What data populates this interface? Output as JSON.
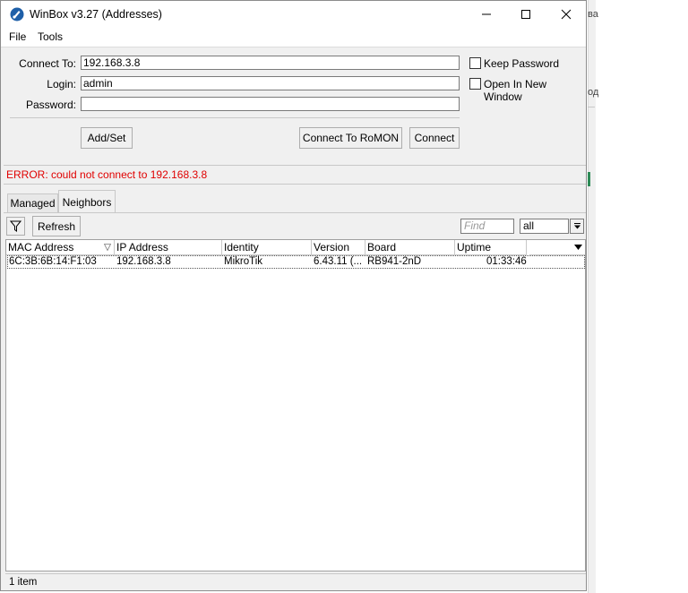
{
  "window": {
    "title": "WinBox v3.27 (Addresses)"
  },
  "menu": {
    "items": [
      {
        "label": "File"
      },
      {
        "label": "Tools"
      }
    ]
  },
  "form": {
    "connect_to_label": "Connect To:",
    "connect_to_value": "192.168.3.8",
    "login_label": "Login:",
    "login_value": "admin",
    "password_label": "Password:",
    "password_value": "",
    "keep_password_label": "Keep Password",
    "open_new_window_label": "Open In New Window"
  },
  "buttons": {
    "add_set": "Add/Set",
    "connect_romon": "Connect To RoMON",
    "connect": "Connect"
  },
  "error": {
    "message": "ERROR: could not connect to 192.168.3.8"
  },
  "tabs": [
    {
      "label": "Managed"
    },
    {
      "label": "Neighbors"
    }
  ],
  "toolbar": {
    "refresh_label": "Refresh",
    "find_placeholder": "Find",
    "filter_value": "all"
  },
  "table": {
    "columns": [
      "MAC Address",
      "IP Address",
      "Identity",
      "Version",
      "Board",
      "Uptime"
    ],
    "rows": [
      {
        "mac": "6C:3B:6B:14:F1:03",
        "ip": "192.168.3.8",
        "identity": "MikroTik",
        "version": "6.43.11 (...",
        "board": "RB941-2nD",
        "uptime": "01:33:46"
      }
    ]
  },
  "status": {
    "count": "1 item"
  },
  "background": {
    "frag1": "ва",
    "frag2": "од"
  },
  "colors": {
    "error": "#e00000",
    "window_bg": "#f0f0f0",
    "app_icon": "#1e5fa8"
  }
}
